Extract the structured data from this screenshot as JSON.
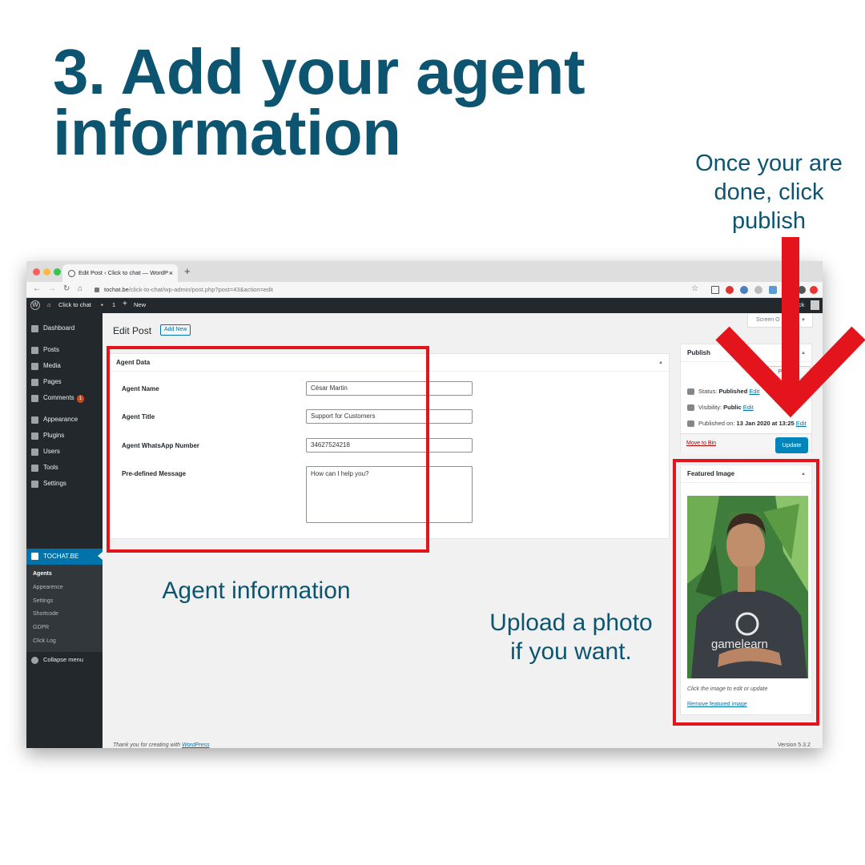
{
  "heading": {
    "line1": "3. Add your agent",
    "line2": "information"
  },
  "callouts": {
    "publish": [
      "Once your are",
      "done, click",
      "publish"
    ],
    "agent": "Agent information",
    "photo": [
      "Upload a photo",
      "if you want."
    ]
  },
  "browser": {
    "tab_title": "Edit Post ‹ Click to chat — WordP",
    "tab_close": "×",
    "new_tab": "+",
    "url_host": "tochat.be",
    "url_path": "/click-to-chat/wp-admin/post.php?post=43&action=edit"
  },
  "adminbar": {
    "site": "Click to chat",
    "comments": "1",
    "new": "New",
    "howdy": "ck"
  },
  "sidebar": {
    "items": [
      "Dashboard",
      "Posts",
      "Media",
      "Pages",
      "Comments",
      "Appearance",
      "Plugins",
      "Users",
      "Tools",
      "Settings",
      "TOCHAT.BE"
    ],
    "comments_badge": "1",
    "submenu": [
      "Agents",
      "Appearence",
      "Settings",
      "Shortcode",
      "GDPR",
      "Click Log"
    ],
    "collapse": "Collapse menu"
  },
  "page": {
    "title": "Edit Post",
    "add_new": "Add New",
    "screen_options": "Screen O"
  },
  "agent_box": {
    "title": "Agent Data",
    "fields": [
      {
        "label": "Agent Name",
        "value": "César Martin"
      },
      {
        "label": "Agent Title",
        "value": "Support for Customers"
      },
      {
        "label": "Agent WhatsApp Number",
        "value": "34627524218"
      },
      {
        "label": "Pre-defined Message",
        "value": "How can I help you?"
      }
    ]
  },
  "publish_box": {
    "title": "Publish",
    "preview": "Preview Changes",
    "status_label": "Status:",
    "status_value": "Published",
    "visibility_label": "Visibility:",
    "visibility_value": "Public",
    "published_label": "Published on:",
    "published_value": "13 Jan 2020 at 13:25",
    "edit": "Edit",
    "move_to_bin": "Move to Bin",
    "update": "Update"
  },
  "featured_box": {
    "title": "Featured Image",
    "caption": "Click the image to edit or update",
    "remove": "Remove featured image",
    "shirt_text": "gamelearn"
  },
  "footer": {
    "thanks": "Thank you for creating with",
    "wp": "WordPress",
    "version": "Version 5.3.2"
  },
  "colors": {
    "heading": "#0d5470",
    "highlight": "#e3141b",
    "wp_blue": "#0073aa",
    "admin_dark": "#23282d"
  }
}
